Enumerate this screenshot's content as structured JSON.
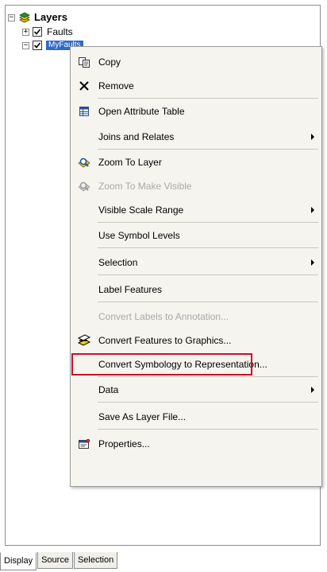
{
  "toc": {
    "root_label": "Layers",
    "layers": [
      {
        "label": "Faults",
        "checked": true
      },
      {
        "label": "MyFaults",
        "checked": true,
        "selected": true
      }
    ]
  },
  "context_menu": {
    "items": [
      {
        "label": "Copy",
        "icon": "copy-icon"
      },
      {
        "label": "Remove",
        "icon": "remove-icon"
      },
      {
        "label": "Open Attribute Table",
        "icon": "table-icon"
      },
      {
        "label": "Joins and Relates",
        "submenu": true
      },
      {
        "label": "Zoom To Layer",
        "icon": "zoom-to-layer-icon"
      },
      {
        "label": "Zoom To Make Visible",
        "icon": "zoom-to-visible-icon",
        "disabled": true
      },
      {
        "label": "Visible Scale Range",
        "submenu": true
      },
      {
        "label": "Use Symbol Levels"
      },
      {
        "label": "Selection",
        "submenu": true
      },
      {
        "label": "Label Features"
      },
      {
        "label": "Convert Labels to Annotation...",
        "disabled": true
      },
      {
        "label": "Convert Features to Graphics...",
        "icon": "convert-features-icon"
      },
      {
        "label": "Convert Symbology to Representation...",
        "highlighted": true
      },
      {
        "label": "Data",
        "submenu": true
      },
      {
        "label": "Save As Layer File..."
      },
      {
        "label": "Properties...",
        "icon": "properties-icon"
      }
    ],
    "highlight_color": "#c8102e"
  },
  "tabs": [
    {
      "label": "Display",
      "active": true
    },
    {
      "label": "Source"
    },
    {
      "label": "Selection"
    }
  ]
}
